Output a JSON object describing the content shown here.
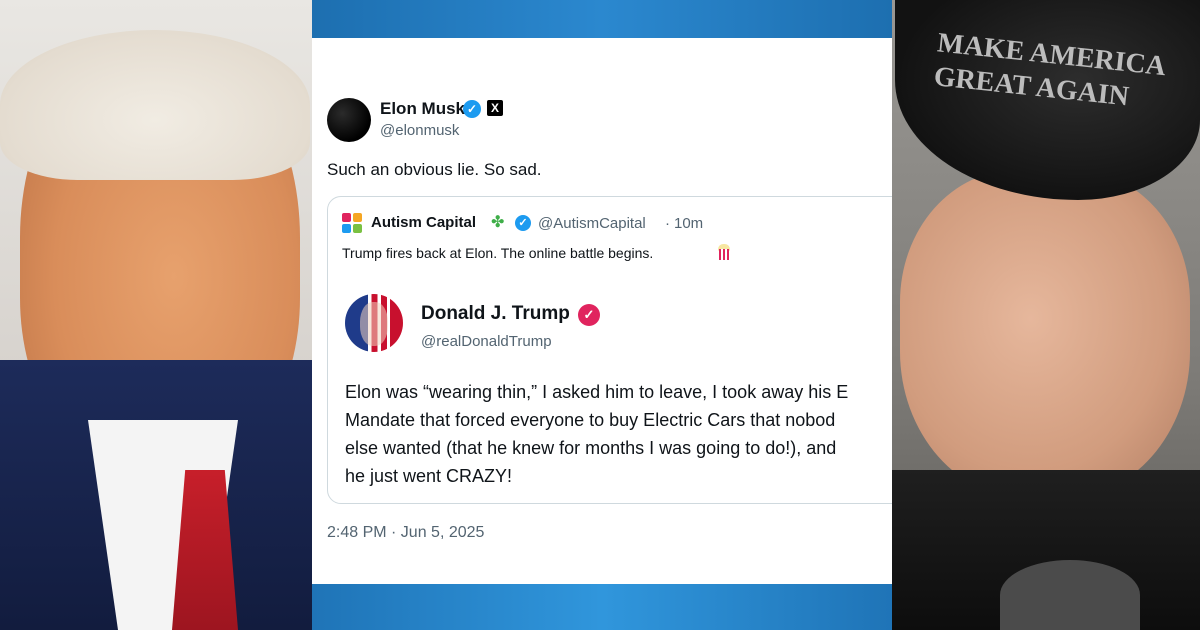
{
  "tweet": {
    "author_name": "Elon Musk",
    "author_handle": "@elonmusk",
    "text": "Such an obvious lie. So sad.",
    "timestamp": "2:48 PM · Jun 5, 2025"
  },
  "quote": {
    "name": "Autism Capital",
    "handle": "@AutismCapital",
    "separator": "·",
    "time": "10m",
    "text": "Trump fires back at Elon. The online battle begins."
  },
  "embedded_post": {
    "name": "Donald J. Trump",
    "handle": "@realDonaldTrump",
    "lines": [
      "Elon was “wearing thin,” I asked him to leave, I took away his E",
      "Mandate that forced everyone to buy Electric Cars that nobod",
      "else wanted (that he knew for months I was going to do!), and",
      "he just went CRAZY!"
    ]
  },
  "photos": {
    "right_cap_text_line1": "MAKE AMERICA",
    "right_cap_text_line2": "GREAT AGAIN"
  },
  "colors": {
    "verified_blue": "#1d9bf0",
    "verified_pink": "#e0245e",
    "band_blue": "#2b88cf",
    "text_primary": "#0f1419",
    "text_secondary": "#536471"
  },
  "icons": [
    "verified-icon",
    "x-logo-icon",
    "clover-icon",
    "popcorn-icon"
  ]
}
